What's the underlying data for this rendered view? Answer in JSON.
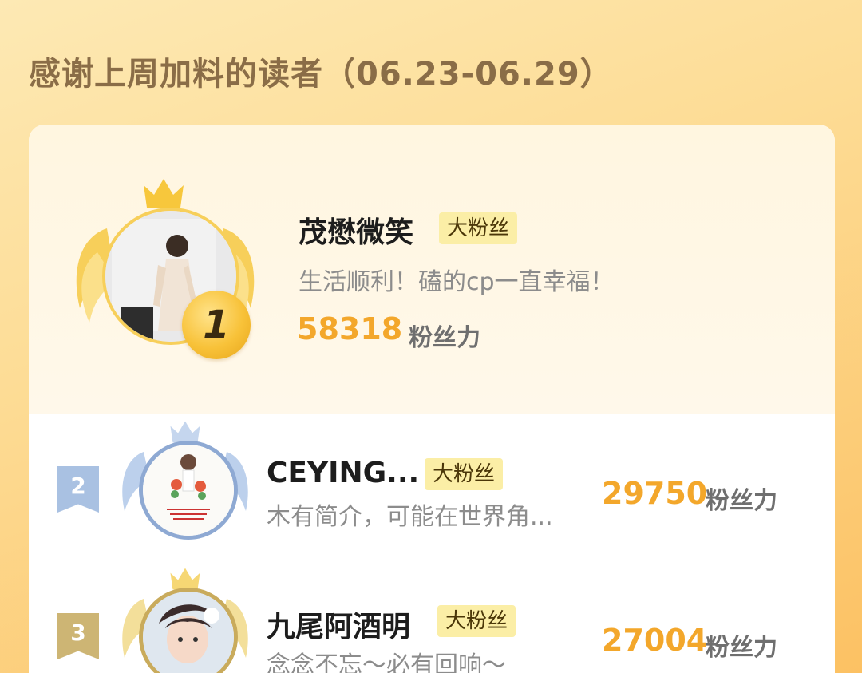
{
  "header": {
    "title": "感谢上周加料的读者（06.23-06.29）"
  },
  "leaderboard": [
    {
      "rank": "1",
      "name": "茂懋微笑",
      "tag": "大粉丝",
      "bio": "生活顺利！磕的cp一直幸福！",
      "score": "58318",
      "score_unit": "粉丝力"
    },
    {
      "rank": "2",
      "name": "CEYING...",
      "tag": "大粉丝",
      "bio": "木有简介，可能在世界角...",
      "score": "29750",
      "score_unit": "粉丝力"
    },
    {
      "rank": "3",
      "name": "九尾阿酒明",
      "tag": "大粉丝",
      "bio": "念念不忘～必有回响～",
      "score": "27004",
      "score_unit": "粉丝力"
    }
  ],
  "colors": {
    "accent_score": "#f3a72b",
    "rank1_gold": "#f8c239",
    "rank2_blue": "#9fb9dd",
    "rank3_gold": "#c9b06a",
    "tag_bg": "#fbeea6"
  },
  "icons": [
    "crown-icon",
    "wings-icon",
    "rank-medal-icon",
    "rank-ribbon-icon"
  ]
}
